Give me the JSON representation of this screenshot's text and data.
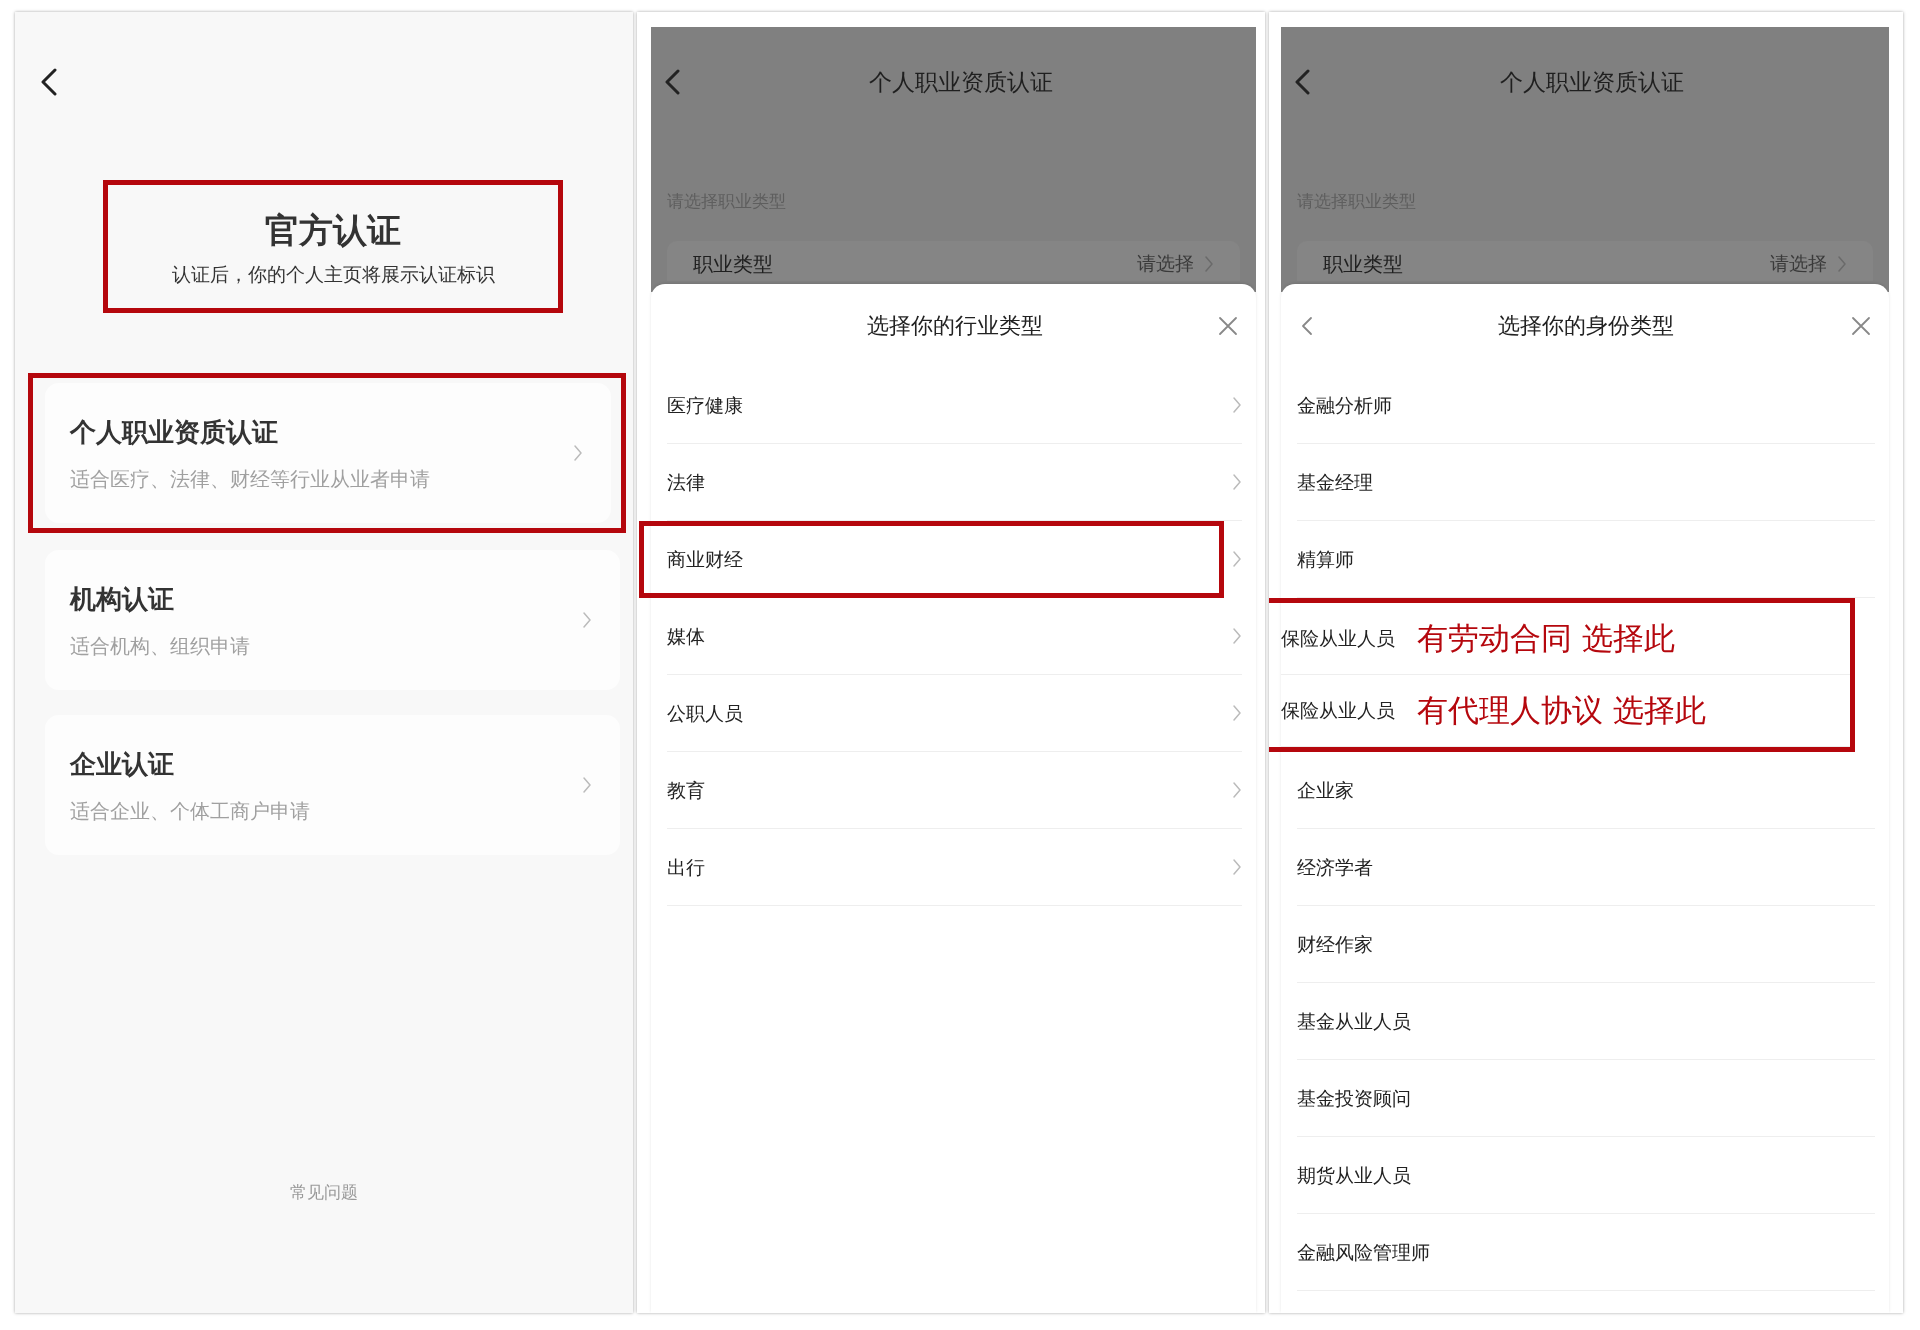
{
  "official_page": {
    "header": {
      "title": "官方认证",
      "subtitle": "认证后，你的个人主页将展示认证标识",
      "highlighted": true
    },
    "options": [
      {
        "title": "个人职业资质认证",
        "subtitle": "适合医疗、法律、财经等行业从业者申请",
        "highlighted": true
      },
      {
        "title": "机构认证",
        "subtitle": "适合机构、组织申请",
        "highlighted": false
      },
      {
        "title": "企业认证",
        "subtitle": "适合企业、个体工商户申请",
        "highlighted": false
      }
    ],
    "footer_link": "常见问题"
  },
  "industry_page": {
    "title": "个人职业资质认证",
    "hint": "请选择职业类型",
    "field": {
      "label": "职业类型",
      "placeholder": "请选择"
    },
    "sheet": {
      "title": "选择你的行业类型",
      "items": [
        {
          "label": "医疗健康",
          "highlighted": false
        },
        {
          "label": "法律",
          "highlighted": false
        },
        {
          "label": "商业财经",
          "highlighted": true
        },
        {
          "label": "媒体",
          "highlighted": false
        },
        {
          "label": "公职人员",
          "highlighted": false
        },
        {
          "label": "教育",
          "highlighted": false
        },
        {
          "label": "出行",
          "highlighted": false
        }
      ]
    }
  },
  "identity_page": {
    "title": "个人职业资质认证",
    "hint": "请选择职业类型",
    "field": {
      "label": "职业类型",
      "placeholder": "请选择"
    },
    "sheet": {
      "title": "选择你的身份类型",
      "items": [
        {
          "kind": "plain",
          "label": "金融分析师"
        },
        {
          "kind": "plain",
          "label": "基金经理"
        },
        {
          "kind": "plain",
          "label": "精算师"
        },
        {
          "kind": "group",
          "highlighted": true,
          "items": [
            {
              "label": "保险从业人员",
              "annotation": "有劳动合同 选择此"
            },
            {
              "label": "保险从业人员",
              "annotation": "有代理人协议 选择此"
            }
          ]
        },
        {
          "kind": "plain",
          "label": "企业家"
        },
        {
          "kind": "plain",
          "label": "经济学者"
        },
        {
          "kind": "plain",
          "label": "财经作家"
        },
        {
          "kind": "plain",
          "label": "基金从业人员"
        },
        {
          "kind": "plain",
          "label": "基金投资顾问"
        },
        {
          "kind": "plain",
          "label": "期货从业人员"
        },
        {
          "kind": "plain",
          "label": "金融风险管理师"
        }
      ]
    }
  }
}
